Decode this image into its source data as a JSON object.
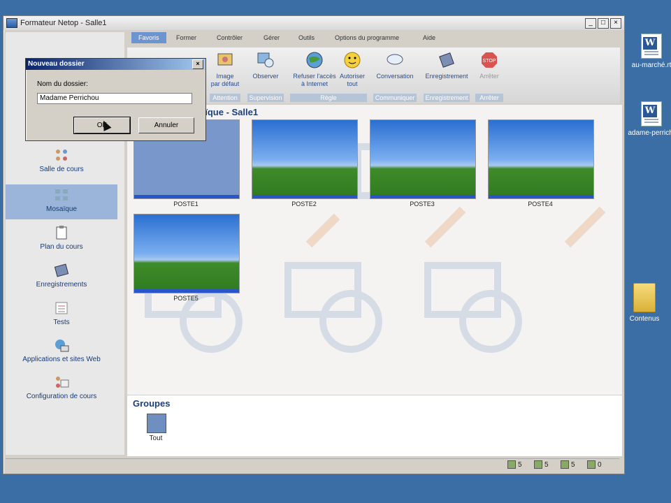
{
  "window": {
    "title": "Formateur Netop - Salle1",
    "controls": [
      "_",
      "□",
      "×"
    ]
  },
  "desktop": {
    "icons": [
      {
        "label": "au-marché.rt",
        "type": "word-doc"
      },
      {
        "label": "adame-perrich.",
        "type": "word-doc"
      },
      {
        "label": "Contenus",
        "type": "folder"
      }
    ]
  },
  "tabs": [
    "Favoris",
    "Former",
    "Contrôler",
    "Gérer",
    "Outils",
    "Options du programme",
    "Aide"
  ],
  "ribbon": {
    "buttons": [
      {
        "label": "Image\npar défaut"
      },
      {
        "label": "Observer"
      },
      {
        "label": "Refuser l'accès\nà Internet"
      },
      {
        "label": "Autoriser\ntout"
      },
      {
        "label": "Conversation"
      },
      {
        "label": "Enregistrement"
      },
      {
        "label": "Arrêter"
      }
    ],
    "groups": [
      "Attention",
      "Supervision",
      "Règle",
      "Communiquer",
      "Enregistrement",
      "Arrêter"
    ]
  },
  "nav": {
    "items": [
      {
        "label": "Salle de cours"
      },
      {
        "label": "Mosaïque"
      },
      {
        "label": "Plan du cours"
      },
      {
        "label": "Enregistrements"
      },
      {
        "label": "Tests"
      },
      {
        "label": "Applications et sites Web"
      },
      {
        "label": "Configuration de cours"
      }
    ]
  },
  "content": {
    "heading": "aïque - Salle1",
    "stations": [
      "POSTE1",
      "POSTE2",
      "POSTE3",
      "POSTE4",
      "POSTE5"
    ]
  },
  "groups": {
    "title": "Groupes",
    "item_label": "Tout"
  },
  "status": {
    "counts": [
      "5",
      "5",
      "5",
      "0"
    ]
  },
  "dialog": {
    "title": "Nouveau dossier",
    "field_label": "Nom du dossier:",
    "field_value": "Madame Perrichou",
    "ok_label": "OK",
    "cancel_label": "Annuler"
  }
}
